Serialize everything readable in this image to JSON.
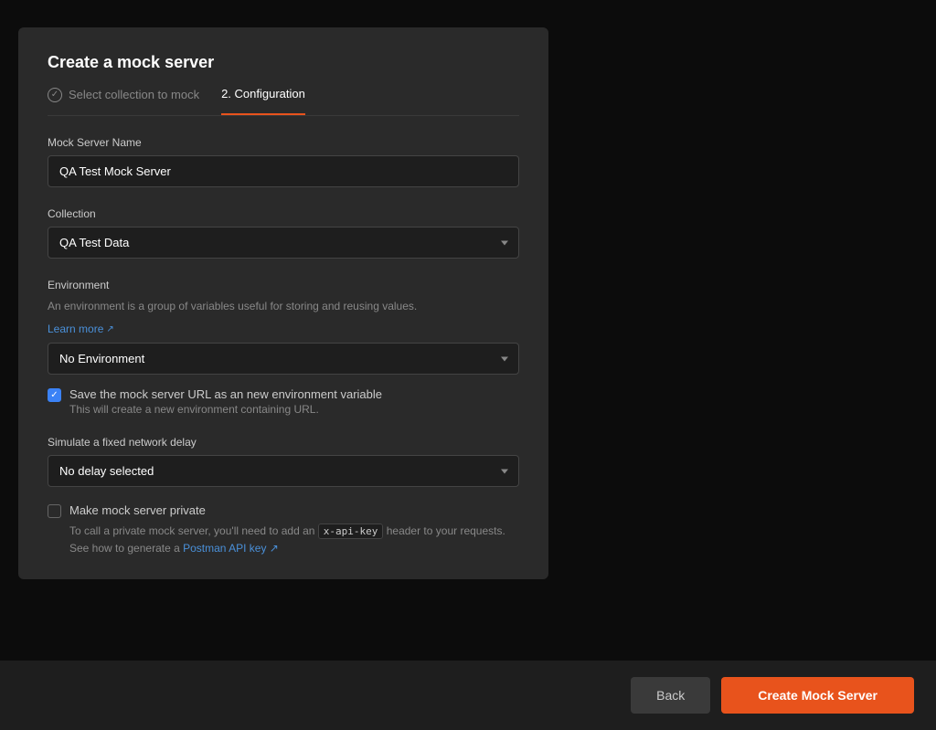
{
  "modal": {
    "title": "Create a mock server",
    "steps": [
      {
        "id": "select-collection",
        "label": "Select collection to mock",
        "status": "completed"
      },
      {
        "id": "configuration",
        "label": "2. Configuration",
        "status": "active"
      }
    ],
    "fields": {
      "mock_server_name": {
        "label": "Mock Server Name",
        "value": "QA Test Mock Server",
        "placeholder": "Mock Server Name"
      },
      "collection": {
        "label": "Collection",
        "value": "QA Test Data",
        "options": [
          "QA Test Data"
        ]
      },
      "environment": {
        "label": "Environment",
        "description": "An environment is a group of variables useful for storing and reusing values.",
        "learn_more_label": "Learn more",
        "value": "No Environment",
        "options": [
          "No Environment"
        ]
      },
      "save_url_checkbox": {
        "checked": true,
        "label": "Save the mock server URL as an new environment variable",
        "sublabel": "This will create a new environment containing URL."
      },
      "network_delay": {
        "label": "Simulate a fixed network delay",
        "value": "No delay selected",
        "options": [
          "No delay selected"
        ]
      },
      "make_private": {
        "checked": false,
        "label": "Make mock server private",
        "description_prefix": "To call a private mock server, you'll need to add an ",
        "description_code": "x-api-key",
        "description_mid": " header to your requests. See how to generate a ",
        "description_link": "Postman API key",
        "description_suffix": ""
      }
    }
  },
  "footer": {
    "back_label": "Back",
    "create_label": "Create Mock Server"
  }
}
